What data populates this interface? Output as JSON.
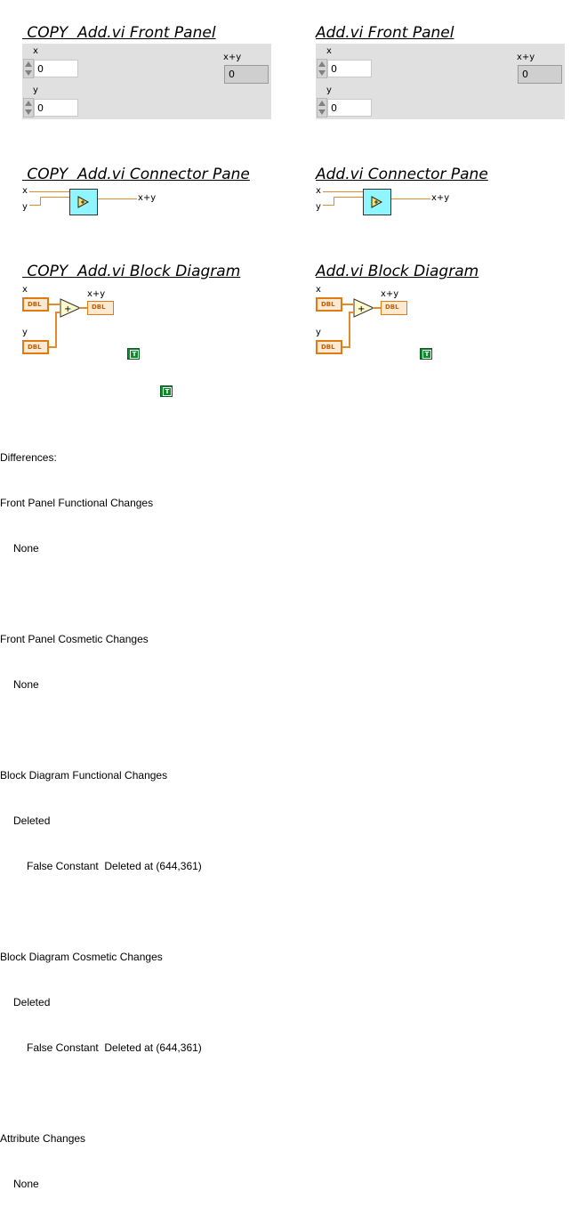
{
  "copy": {
    "fp_title": " COPY  Add.vi Front Panel",
    "cp_title": " COPY  Add.vi Connector Pane",
    "bd_title": " COPY  Add.vi Block Diagram"
  },
  "orig": {
    "fp_title": "Add.vi Front Panel",
    "cp_title": "Add.vi Connector Pane",
    "bd_title": "Add.vi Block Diagram"
  },
  "fp": {
    "x_label": "x",
    "y_label": "y",
    "sum_label": "x+y",
    "x_value": "0",
    "y_value": "0",
    "sum_value": "0"
  },
  "cp": {
    "x": "x",
    "y": "y",
    "sum": "x+y"
  },
  "bd": {
    "x": "x",
    "y": "y",
    "sum": "x+y",
    "dbl": "DBL",
    "plus": "+",
    "true_glyph": "T"
  },
  "differences": {
    "heading": "Differences:",
    "fp_func": "Front Panel Functional Changes",
    "fp_func_v": "None",
    "fp_cos": "Front Panel Cosmetic Changes",
    "fp_cos_v": "None",
    "bd_func": "Block Diagram Functional Changes",
    "bd_func_deleted": "Deleted",
    "bd_func_item": "False Constant  Deleted at (644,361)",
    "bd_cos": "Block Diagram Cosmetic Changes",
    "bd_cos_deleted": "Deleted",
    "bd_cos_item": "False Constant  Deleted at (644,361)",
    "attr": "Attribute Changes",
    "attr_v": "None"
  },
  "colors": {
    "wire_orange": "#e28b2c",
    "vi_icon_cyan": "#8ff5ff",
    "bool_green": "#0f8a2c",
    "panel_gray": "#e0e0e0"
  }
}
